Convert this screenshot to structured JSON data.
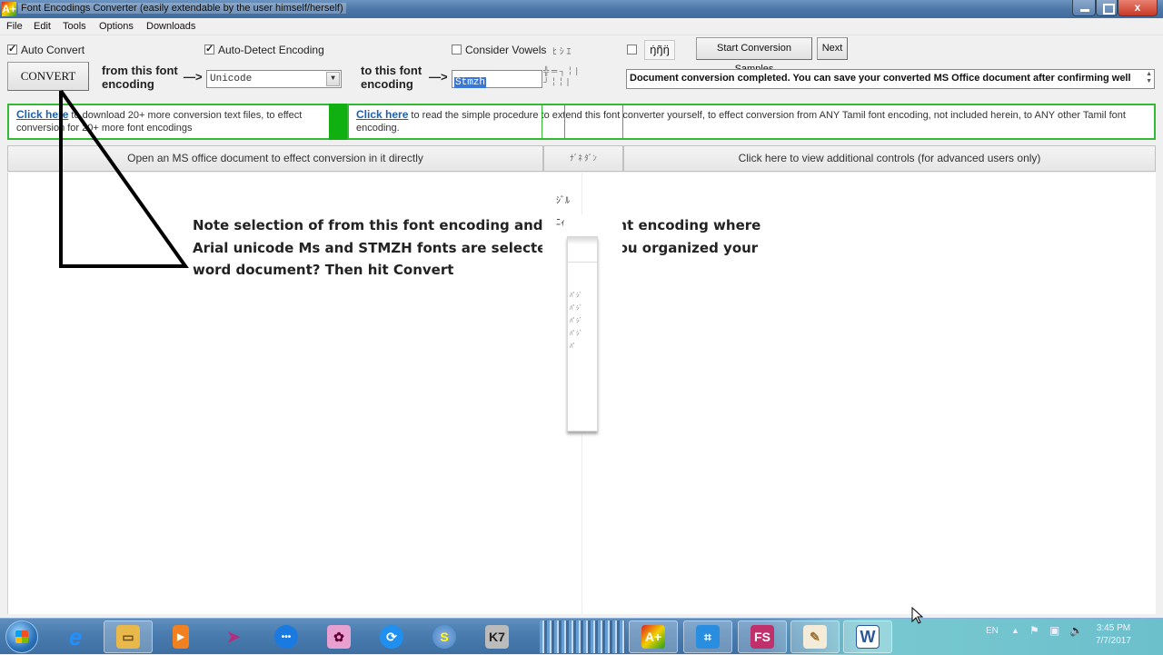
{
  "window": {
    "title": "Font Encodings Converter (easily extendable by the user himself/herself)",
    "app_icon": "A+",
    "controls": {
      "minimize": "minimize",
      "maximize": "maximize",
      "close": "x"
    }
  },
  "menu": [
    "File",
    "Edit",
    "Tools",
    "Options",
    "Downloads"
  ],
  "options": {
    "auto_convert": {
      "label": "Auto Convert",
      "checked": true
    },
    "auto_detect": {
      "label": "Auto-Detect Encoding",
      "checked": true
    },
    "consider_vowels": {
      "label": "Consider Vowels",
      "checked": false
    },
    "tamil_sample": {
      "label": "ŋ̇ŋ̃ŋ̈",
      "checked": false
    }
  },
  "toolbar": {
    "convert_label": "CONVERT",
    "from_label": "from this font encoding",
    "from_line1": "from this font",
    "from_line2": "encoding",
    "from_value": "Unicode",
    "arrow": "—>",
    "to_line1": "to this font",
    "to_line2": "encoding",
    "to_value": "Stmzh",
    "start_samples_label": "Start Conversion Samples",
    "next_label": "Next",
    "status_message": "Document conversion completed. You can save your converted MS Office document after confirming well"
  },
  "links": {
    "left": {
      "link_text": "Click here",
      "text": " to download 20+ more conversion text files, to effect conversion for 20+ more font encodings"
    },
    "right": {
      "link_text": "Click here",
      "text": " to read the simple procedure to extend this font converter yourself, to effect conversion from ANY Tamil font encoding, not included herein, to ANY other Tamil font encoding."
    }
  },
  "actions": {
    "open_doc": "Open an MS office document to effect conversion in it directly",
    "additional_controls": "Click here to view additional controls (for advanced users only)"
  },
  "annotation": {
    "note": "Note selection of from this font encoding  and to this font encoding where Arial unicode Ms and STMZH fonts are selected. Have you organized your word document? Then hit Convert"
  },
  "taskbar": {
    "apps": [
      {
        "name": "internet-explorer",
        "glyph": "e",
        "color": "#1e90ff"
      },
      {
        "name": "file-explorer",
        "glyph": "▭",
        "color": "#e8b84a",
        "active": true
      },
      {
        "name": "media-player",
        "glyph": "▶",
        "color": "#f08020"
      },
      {
        "name": "arrow-app",
        "glyph": "➤",
        "color": "#b03080"
      },
      {
        "name": "chat-app",
        "glyph": "•••",
        "color": "#1a7ae0"
      },
      {
        "name": "photo-app",
        "glyph": "✿",
        "color": "#e080c0"
      },
      {
        "name": "shareit",
        "glyph": "⟳",
        "color": "#2090f0"
      },
      {
        "name": "globe-app",
        "glyph": "S",
        "color": "#3a88c8"
      },
      {
        "name": "k7-antivirus",
        "glyph": "K7",
        "color": "#444444"
      },
      {
        "name": "font-converter",
        "glyph": "A+",
        "color": "#e02020",
        "active": true
      },
      {
        "name": "screen-capture",
        "glyph": "⌗",
        "color": "#2a8ee0",
        "active": true
      },
      {
        "name": "fs-app",
        "glyph": "FS",
        "color": "#c0306a",
        "active": true
      },
      {
        "name": "paint",
        "glyph": "✎",
        "color": "#d0a050",
        "active": true
      },
      {
        "name": "word",
        "glyph": "W",
        "color": "#2b579a",
        "active": true
      }
    ],
    "language": "EN",
    "time": "3:45 PM",
    "date": "7/7/2017"
  }
}
